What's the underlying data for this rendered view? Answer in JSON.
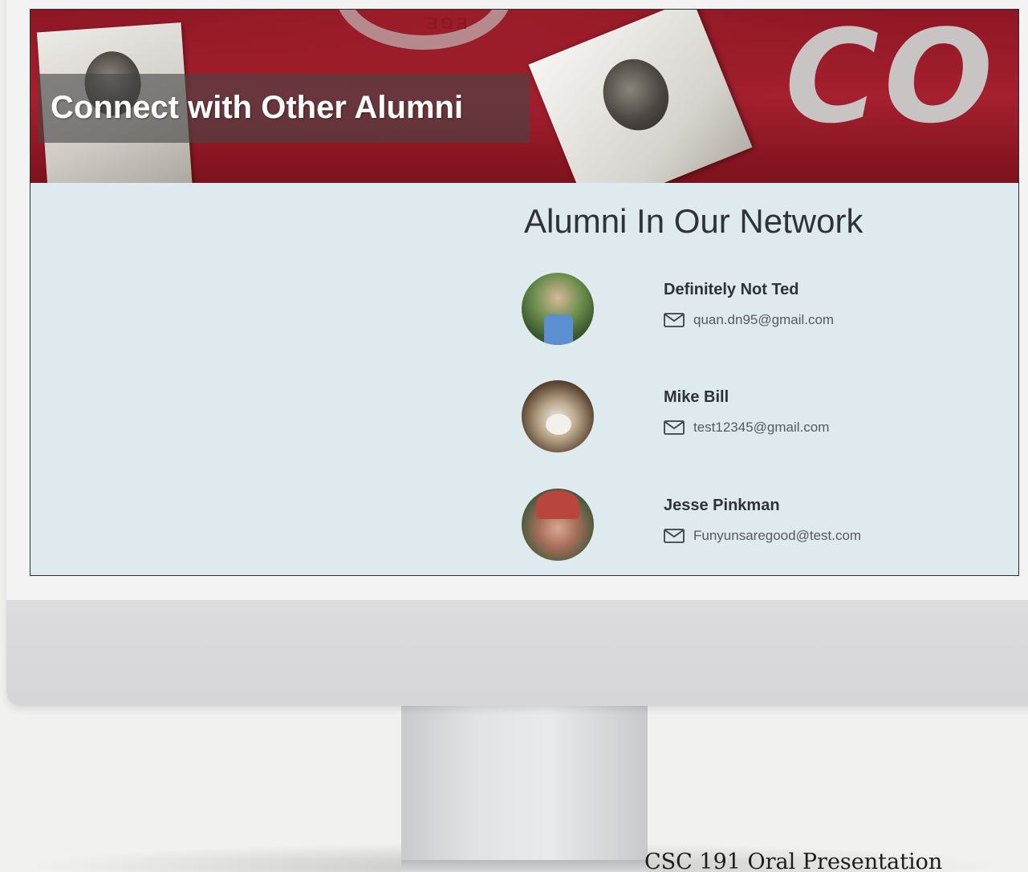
{
  "hero": {
    "title": "Connect with Other Alumni",
    "seal_text": "EGE",
    "background_letters": "CO",
    "brand_color": "#a5202f"
  },
  "network": {
    "title": "Alumni In Our Network",
    "alumni": [
      {
        "name": "Definitely Not Ted",
        "email": "quan.dn95@gmail.com",
        "icon": "mail-icon"
      },
      {
        "name": "Mike Bill",
        "email": "test12345@gmail.com",
        "icon": "mail-icon"
      },
      {
        "name": "Jesse Pinkman",
        "email": "Funyunsaregood@test.com",
        "icon": "mail-icon"
      }
    ]
  },
  "footer": {
    "caption": "CSC 191 Oral Presentation"
  }
}
